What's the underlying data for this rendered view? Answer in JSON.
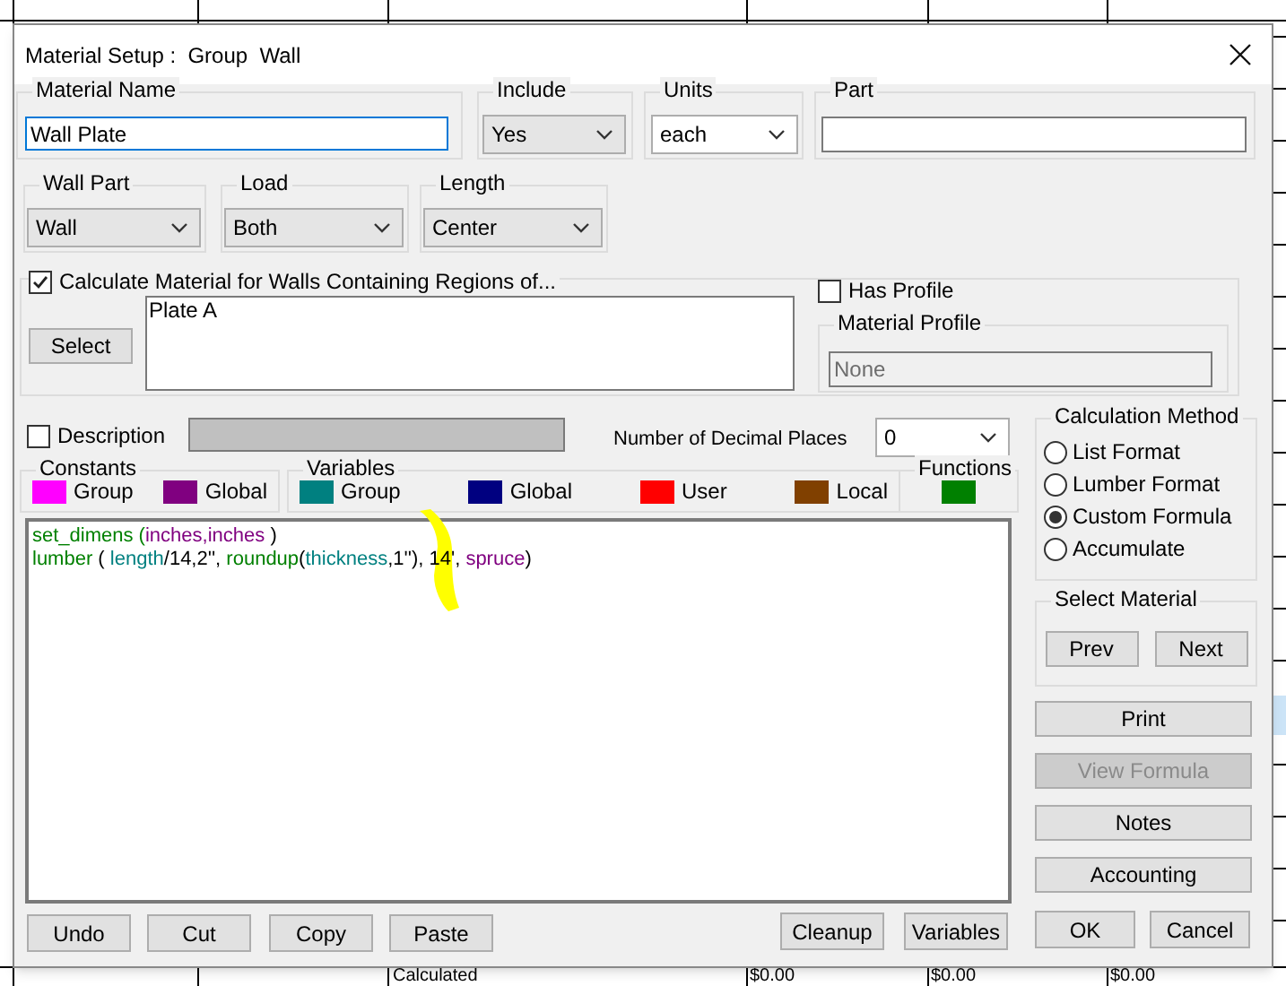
{
  "window": {
    "title": "Material Setup :  Group  Wall"
  },
  "material_name": {
    "label": "Material Name",
    "value": "Wall Plate"
  },
  "include": {
    "label": "Include",
    "value": "Yes"
  },
  "units": {
    "label": "Units",
    "value": "each"
  },
  "part": {
    "label": "Part"
  },
  "wall_part": {
    "label": "Wall Part",
    "value": "Wall"
  },
  "load": {
    "label": "Load",
    "value": "Both"
  },
  "length": {
    "label": "Length",
    "value": "Center"
  },
  "calculate_regions": {
    "label": "Calculate Material for Walls Containing Regions of...",
    "checked": true,
    "select_button": "Select",
    "regions": [
      "Plate A"
    ]
  },
  "has_profile": {
    "label": "Has Profile",
    "checked": false
  },
  "material_profile": {
    "label": "Material Profile",
    "value": "None",
    "disabled": true
  },
  "description": {
    "label": "Description",
    "checked": false
  },
  "decimal_places": {
    "label": "Number of Decimal Places",
    "value": "0"
  },
  "legend": [
    {
      "title": "Constants",
      "items": [
        {
          "label": "Group",
          "color": "#ff00ff"
        },
        {
          "label": "Global",
          "color": "#800080"
        }
      ]
    },
    {
      "title": "Variables",
      "items": [
        {
          "label": "Group",
          "color": "#008080"
        },
        {
          "label": "Global",
          "color": "#000080"
        },
        {
          "label": "User",
          "color": "#ff0000"
        },
        {
          "label": "Local",
          "color": "#804000"
        }
      ]
    },
    {
      "title": "Functions",
      "items": [
        {
          "color": "#008000"
        }
      ]
    }
  ],
  "formula": {
    "lines": [
      [
        {
          "text": "set_dimens (",
          "kind": "function"
        },
        {
          "text": "inches,inches",
          "kind": "constant"
        },
        {
          "text": " )",
          "kind": "plain"
        }
      ],
      [
        {
          "text": "lumber",
          "kind": "function"
        },
        {
          "text": " ( ",
          "kind": "plain"
        },
        {
          "text": "length",
          "kind": "variable"
        },
        {
          "text": "/14,2'', ",
          "kind": "plain"
        },
        {
          "text": "roundup",
          "kind": "function"
        },
        {
          "text": "(",
          "kind": "plain"
        },
        {
          "text": "thickness",
          "kind": "variable"
        },
        {
          "text": ",1''), 14', ",
          "kind": "plain"
        },
        {
          "text": "spruce",
          "kind": "constant"
        },
        {
          "text": ")",
          "kind": "plain"
        }
      ]
    ]
  },
  "editor_buttons": [
    "Undo",
    "Cut",
    "Copy",
    "Paste"
  ],
  "editor_tools": [
    "Cleanup",
    "Variables"
  ],
  "calculation_method": {
    "title": "Calculation Method",
    "options": [
      {
        "label": "List Format",
        "selected": false
      },
      {
        "label": "Lumber Format",
        "selected": false
      },
      {
        "label": "Custom Formula",
        "selected": true
      },
      {
        "label": "Accumulate",
        "selected": false
      }
    ]
  },
  "select_material": {
    "title": "Select Material",
    "buttons": [
      "Prev",
      "Next"
    ]
  },
  "side_buttons": [
    {
      "label": "Print",
      "disabled": false
    },
    {
      "label": "View Formula",
      "disabled": true
    },
    {
      "label": "Notes",
      "disabled": false
    },
    {
      "label": "Accounting",
      "disabled": false
    }
  ],
  "dialog_buttons": [
    "OK",
    "Cancel"
  ],
  "background_row": [
    "Calculated",
    "$0.00",
    "$0.00",
    "$0.00"
  ]
}
